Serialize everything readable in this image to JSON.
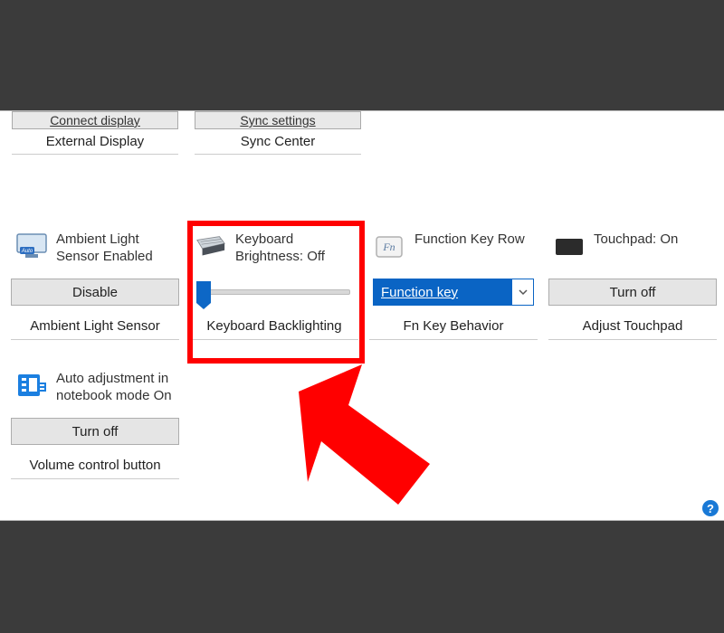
{
  "top": {
    "items": [
      {
        "link": "Connect display",
        "caption": "External Display"
      },
      {
        "link": "Sync settings",
        "caption": "Sync Center"
      }
    ]
  },
  "tiles": {
    "ambient": {
      "title": "Ambient Light Sensor Enabled",
      "button": "Disable",
      "footer": "Ambient Light Sensor"
    },
    "keyboard": {
      "title": "Keyboard Brightness: Off",
      "footer": "Keyboard Backlighting"
    },
    "fnkey": {
      "title": "Function Key Row",
      "select": "Function key",
      "footer": "Fn Key Behavior"
    },
    "touchpad": {
      "title": "Touchpad: On",
      "button": "Turn off",
      "footer": "Adjust Touchpad"
    },
    "autoadjust": {
      "title": "Auto adjustment in notebook mode On",
      "button": "Turn off",
      "footer": "Volume control button"
    }
  },
  "icons": {
    "fn_label": "Fn"
  },
  "help": "?"
}
